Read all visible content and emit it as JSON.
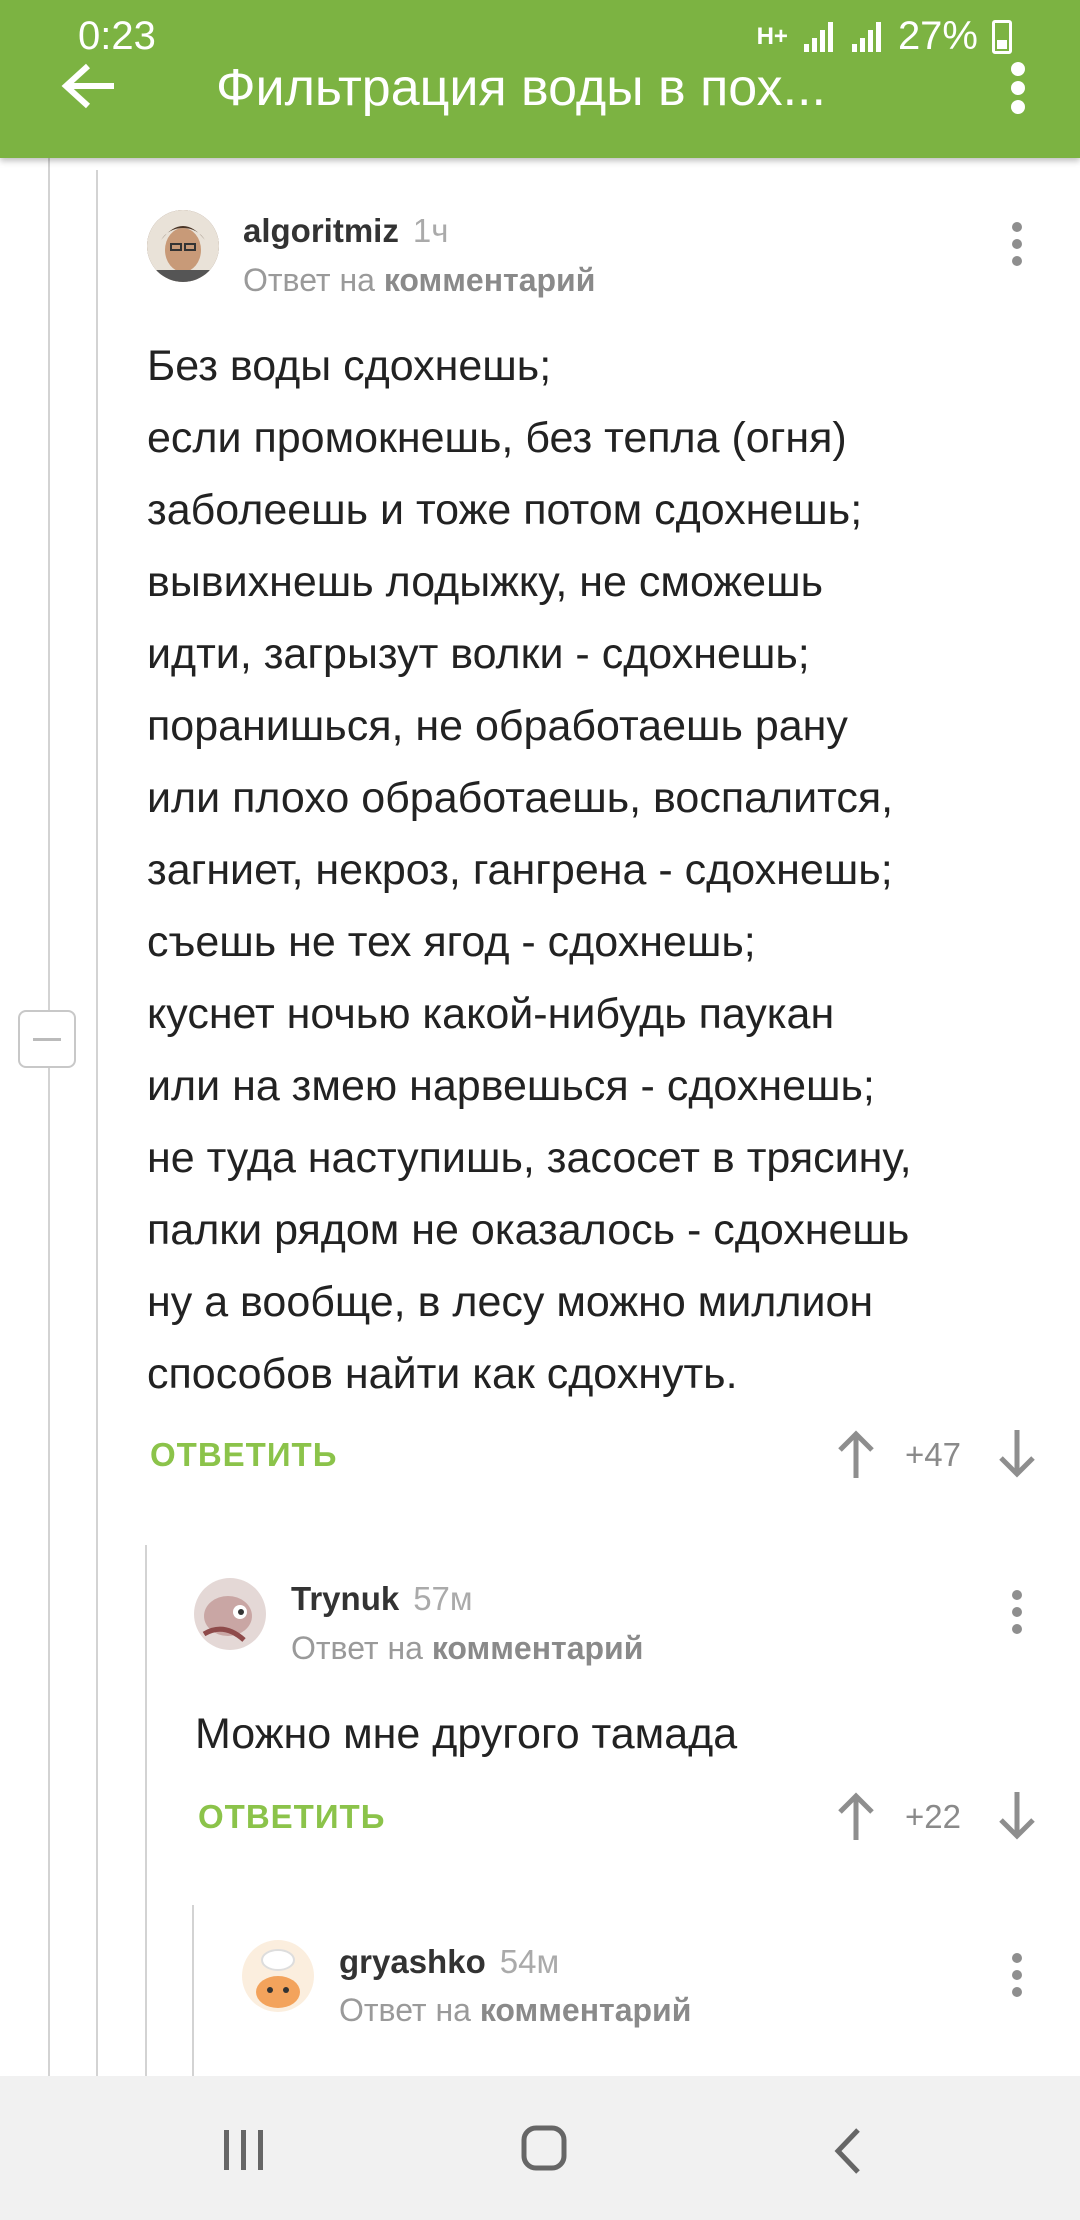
{
  "status_bar": {
    "time": "0:23",
    "network": "H+",
    "battery": "27%"
  },
  "app_bar": {
    "title": "Фильтрация воды в пох..."
  },
  "comments": [
    {
      "author": "algoritmiz",
      "time": "1ч",
      "reply_prefix": "Ответ на",
      "reply_link": "комментарий",
      "lines": [
        "Без воды сдохнешь;",
        "если промокнешь, без тепла (огня)",
        "заболеешь и тоже потом сдохнешь;",
        "вывихнешь лодыжку, не сможешь",
        "идти, загрызут волки - сдохнешь;",
        "поранишься, не обработаешь рану",
        "или плохо обработаешь, воспалится,",
        "загниет, некроз, гангрена - сдохнешь;",
        "съешь не тех ягод - сдохнешь;",
        "куснет ночью какой-нибудь паукан",
        "или на змею нарвешься - сдохнешь;",
        "не туда наступишь, засосет в трясину,",
        "палки рядом не оказалось - сдохнешь",
        "ну а вообще, в лесу можно миллион",
        "способов найти как сдохнуть."
      ],
      "reply_label": "ОТВЕТИТЬ",
      "score": "+47"
    },
    {
      "author": "Trynuk",
      "time": "57м",
      "reply_prefix": "Ответ на",
      "reply_link": "комментарий",
      "text": "Можно мне другого тамада",
      "reply_label": "ОТВЕТИТЬ",
      "score": "+22"
    },
    {
      "author": "gryashko",
      "time": "54м",
      "reply_prefix": "Ответ на",
      "reply_link": "комментарий"
    }
  ],
  "colors": {
    "accent": "#7cb342",
    "reply": "#8bc34a",
    "muted": "#9a9a9a"
  }
}
